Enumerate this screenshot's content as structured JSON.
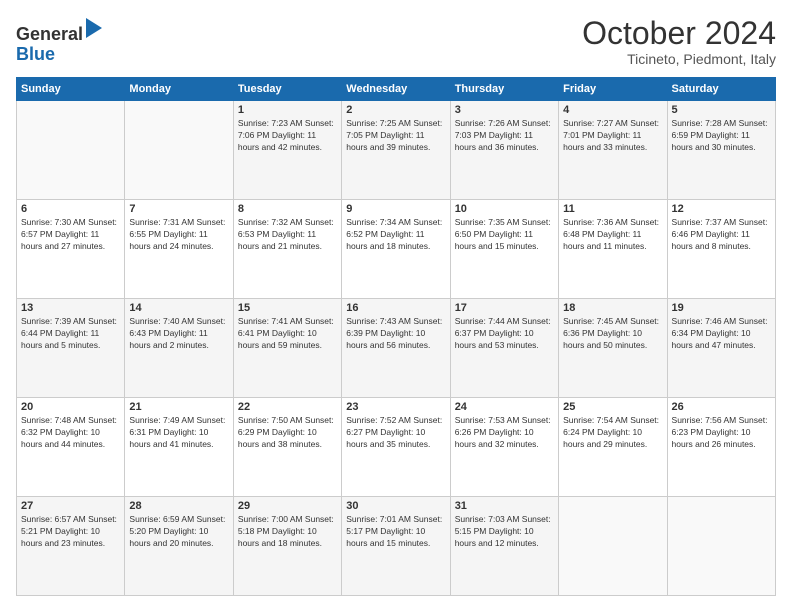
{
  "header": {
    "logo_general": "General",
    "logo_blue": "Blue",
    "month_title": "October 2024",
    "location": "Ticineto, Piedmont, Italy"
  },
  "calendar": {
    "days_of_week": [
      "Sunday",
      "Monday",
      "Tuesday",
      "Wednesday",
      "Thursday",
      "Friday",
      "Saturday"
    ],
    "weeks": [
      [
        {
          "day": "",
          "info": ""
        },
        {
          "day": "",
          "info": ""
        },
        {
          "day": "1",
          "info": "Sunrise: 7:23 AM\nSunset: 7:06 PM\nDaylight: 11 hours and 42 minutes."
        },
        {
          "day": "2",
          "info": "Sunrise: 7:25 AM\nSunset: 7:05 PM\nDaylight: 11 hours and 39 minutes."
        },
        {
          "day": "3",
          "info": "Sunrise: 7:26 AM\nSunset: 7:03 PM\nDaylight: 11 hours and 36 minutes."
        },
        {
          "day": "4",
          "info": "Sunrise: 7:27 AM\nSunset: 7:01 PM\nDaylight: 11 hours and 33 minutes."
        },
        {
          "day": "5",
          "info": "Sunrise: 7:28 AM\nSunset: 6:59 PM\nDaylight: 11 hours and 30 minutes."
        }
      ],
      [
        {
          "day": "6",
          "info": "Sunrise: 7:30 AM\nSunset: 6:57 PM\nDaylight: 11 hours and 27 minutes."
        },
        {
          "day": "7",
          "info": "Sunrise: 7:31 AM\nSunset: 6:55 PM\nDaylight: 11 hours and 24 minutes."
        },
        {
          "day": "8",
          "info": "Sunrise: 7:32 AM\nSunset: 6:53 PM\nDaylight: 11 hours and 21 minutes."
        },
        {
          "day": "9",
          "info": "Sunrise: 7:34 AM\nSunset: 6:52 PM\nDaylight: 11 hours and 18 minutes."
        },
        {
          "day": "10",
          "info": "Sunrise: 7:35 AM\nSunset: 6:50 PM\nDaylight: 11 hours and 15 minutes."
        },
        {
          "day": "11",
          "info": "Sunrise: 7:36 AM\nSunset: 6:48 PM\nDaylight: 11 hours and 11 minutes."
        },
        {
          "day": "12",
          "info": "Sunrise: 7:37 AM\nSunset: 6:46 PM\nDaylight: 11 hours and 8 minutes."
        }
      ],
      [
        {
          "day": "13",
          "info": "Sunrise: 7:39 AM\nSunset: 6:44 PM\nDaylight: 11 hours and 5 minutes."
        },
        {
          "day": "14",
          "info": "Sunrise: 7:40 AM\nSunset: 6:43 PM\nDaylight: 11 hours and 2 minutes."
        },
        {
          "day": "15",
          "info": "Sunrise: 7:41 AM\nSunset: 6:41 PM\nDaylight: 10 hours and 59 minutes."
        },
        {
          "day": "16",
          "info": "Sunrise: 7:43 AM\nSunset: 6:39 PM\nDaylight: 10 hours and 56 minutes."
        },
        {
          "day": "17",
          "info": "Sunrise: 7:44 AM\nSunset: 6:37 PM\nDaylight: 10 hours and 53 minutes."
        },
        {
          "day": "18",
          "info": "Sunrise: 7:45 AM\nSunset: 6:36 PM\nDaylight: 10 hours and 50 minutes."
        },
        {
          "day": "19",
          "info": "Sunrise: 7:46 AM\nSunset: 6:34 PM\nDaylight: 10 hours and 47 minutes."
        }
      ],
      [
        {
          "day": "20",
          "info": "Sunrise: 7:48 AM\nSunset: 6:32 PM\nDaylight: 10 hours and 44 minutes."
        },
        {
          "day": "21",
          "info": "Sunrise: 7:49 AM\nSunset: 6:31 PM\nDaylight: 10 hours and 41 minutes."
        },
        {
          "day": "22",
          "info": "Sunrise: 7:50 AM\nSunset: 6:29 PM\nDaylight: 10 hours and 38 minutes."
        },
        {
          "day": "23",
          "info": "Sunrise: 7:52 AM\nSunset: 6:27 PM\nDaylight: 10 hours and 35 minutes."
        },
        {
          "day": "24",
          "info": "Sunrise: 7:53 AM\nSunset: 6:26 PM\nDaylight: 10 hours and 32 minutes."
        },
        {
          "day": "25",
          "info": "Sunrise: 7:54 AM\nSunset: 6:24 PM\nDaylight: 10 hours and 29 minutes."
        },
        {
          "day": "26",
          "info": "Sunrise: 7:56 AM\nSunset: 6:23 PM\nDaylight: 10 hours and 26 minutes."
        }
      ],
      [
        {
          "day": "27",
          "info": "Sunrise: 6:57 AM\nSunset: 5:21 PM\nDaylight: 10 hours and 23 minutes."
        },
        {
          "day": "28",
          "info": "Sunrise: 6:59 AM\nSunset: 5:20 PM\nDaylight: 10 hours and 20 minutes."
        },
        {
          "day": "29",
          "info": "Sunrise: 7:00 AM\nSunset: 5:18 PM\nDaylight: 10 hours and 18 minutes."
        },
        {
          "day": "30",
          "info": "Sunrise: 7:01 AM\nSunset: 5:17 PM\nDaylight: 10 hours and 15 minutes."
        },
        {
          "day": "31",
          "info": "Sunrise: 7:03 AM\nSunset: 5:15 PM\nDaylight: 10 hours and 12 minutes."
        },
        {
          "day": "",
          "info": ""
        },
        {
          "day": "",
          "info": ""
        }
      ]
    ]
  }
}
